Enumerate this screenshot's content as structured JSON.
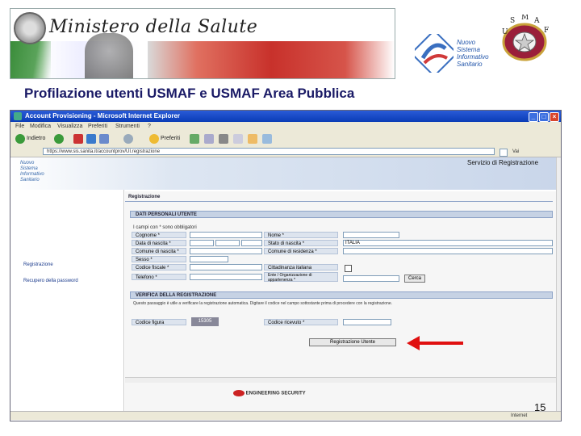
{
  "header": {
    "ministry_title": "Ministero della Salute",
    "nsis_logo_lines": [
      "Nuovo",
      "Sistema",
      "Informativo",
      "Sanitario"
    ],
    "seal_letters": "USMAF"
  },
  "slide": {
    "title": "Profilazione utenti USMAF e USMAF Area Pubblica",
    "page_number": "15"
  },
  "browser": {
    "title": "Account Provisioning - Microsoft Internet Explorer",
    "menu": [
      "File",
      "Modifica",
      "Visualizza",
      "Preferiti",
      "Strumenti",
      "?"
    ],
    "toolbar": {
      "back_label": "Indietro",
      "favorites_label": "Preferiti"
    },
    "address": "https://www.sis.sanita.it/accountprov/UI.registrazione",
    "go_label": "Vai",
    "status": "Internet"
  },
  "page": {
    "service_label": "Servizio di Registrazione",
    "left_links": [
      "Registrazione",
      "Recupero della password"
    ],
    "section_title": "Registrazione",
    "personal_data_header": "DATI PERSONALI UTENTE",
    "required_note": "I campi con * sono obbligatori",
    "fields": {
      "cognome": "Cognome *",
      "nome": "Nome *",
      "data_nascita": "Data di nascita *",
      "stato_nascita": "Stato di nascita *",
      "stato_nascita_value": "ITALIA",
      "comune_nascita": "Comune di nascita *",
      "comune_residenza": "Comune di residenza *",
      "sesso": "Sesso *",
      "codice_fiscale": "Codice fiscale *",
      "cittadinanza_italiana": "Cittadinanza italiana",
      "telefono": "Telefono *",
      "ente_appartenenza": "Ente / Organizzazione di appartenenza *"
    },
    "cerca_label": "Cerca",
    "security_header": "VERIFICA DELLA REGISTRAZIONE",
    "security_note": "Questo passaggio è utile a verificare la registrazione automatica. Digitare il codice nel campo sottostante prima di procedere con la registrazione.",
    "codice_label": "Codice figura",
    "codice_value": "15305",
    "codice_input_label": "Codice ricevuto *",
    "submit_label": "Registrazione Utente",
    "footer_brand": "ENGINEERING SECURITY"
  },
  "colors": {
    "slide_title": "#1a1a66",
    "arrow": "#e01010",
    "ie_titlebar": "#0a3cb6"
  }
}
